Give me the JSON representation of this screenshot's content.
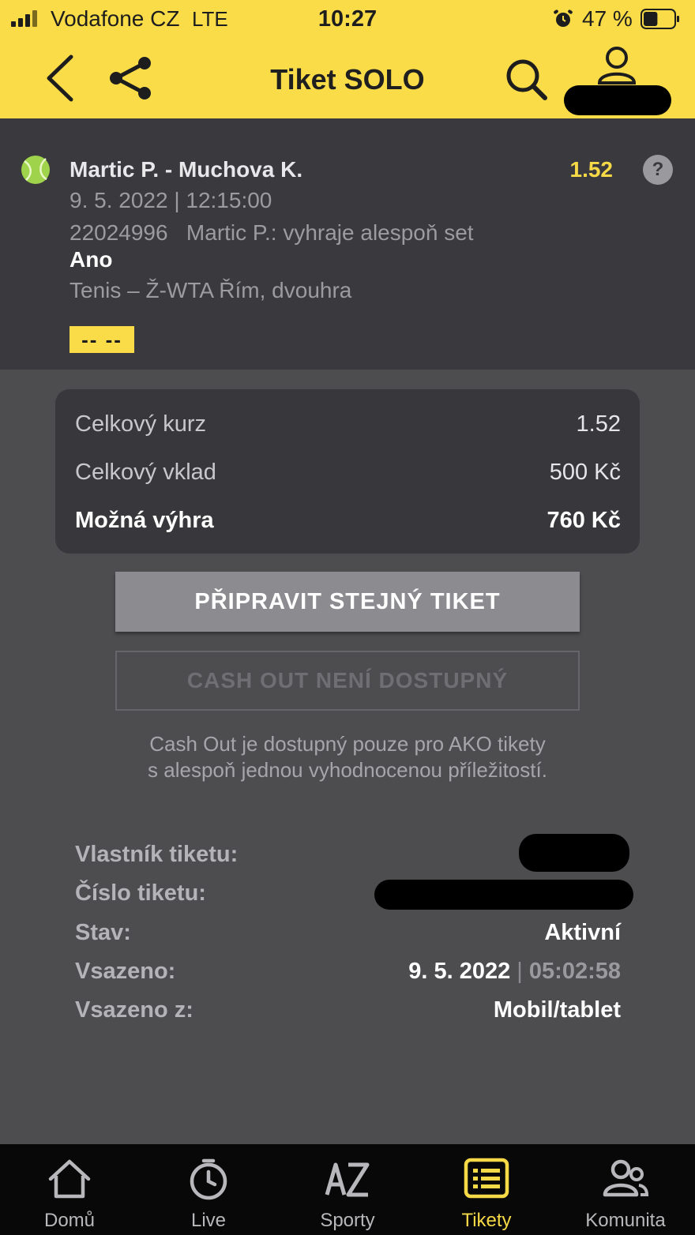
{
  "status_bar": {
    "carrier": "Vodafone CZ",
    "network": "LTE",
    "time": "10:27",
    "battery": "47 %",
    "battery_level": 0.47,
    "icons": [
      "signal-icon",
      "alarm-icon",
      "battery-icon"
    ]
  },
  "nav": {
    "title": "Tiket SOLO",
    "icons": [
      "back-icon",
      "share-icon",
      "search-icon",
      "user-icon"
    ]
  },
  "bet": {
    "match": "Martic P. - Muchova K.",
    "odds": "1.52",
    "datetime": "9. 5. 2022 | 12:15:00",
    "event_id": "22024996",
    "market": "Martic P.: vyhraje alespoň set",
    "pick": "Ano",
    "competition": "Tenis – Ž-WTA Řím, dvouhra",
    "result": "-- --",
    "help": "?"
  },
  "summary": {
    "rows": [
      {
        "label": "Celkový kurz",
        "value": "1.52"
      },
      {
        "label": "Celkový vklad",
        "value": "500 Kč"
      },
      {
        "label": "Možná výhra",
        "value": "760 Kč"
      }
    ]
  },
  "actions": {
    "repeat_label": "PŘIPRAVIT STEJNÝ TIKET",
    "cashout_label": "CASH OUT NENÍ DOSTUPNÝ",
    "cashout_note_1": "Cash Out je dostupný pouze pro AKO tikety",
    "cashout_note_2": "s alespoň jednou vyhodnocenou příležitostí."
  },
  "ticket_info": {
    "owner_label": "Vlastník tiketu:",
    "number_label": "Číslo tiketu:",
    "status_label": "Stav:",
    "status_value": "Aktivní",
    "placed_label": "Vsazeno:",
    "placed_date": "9. 5. 2022",
    "placed_sep": "|",
    "placed_time": "05:02:58",
    "source_label": "Vsazeno z:",
    "source_value": "Mobil/tablet"
  },
  "tabs": [
    {
      "label": "Domů",
      "icon": "home-icon",
      "active": false
    },
    {
      "label": "Live",
      "icon": "live-clock-icon",
      "active": false
    },
    {
      "label": "Sporty",
      "icon": "az-icon",
      "active": false
    },
    {
      "label": "Tikety",
      "icon": "ticket-icon",
      "active": true
    },
    {
      "label": "Komunita",
      "icon": "community-icon",
      "active": false
    }
  ],
  "colors": {
    "brand_yellow": "#f9dc48",
    "odds_yellow": "#f6d947",
    "dark_panel": "#3a3a3e",
    "background": "#4d4d50"
  }
}
